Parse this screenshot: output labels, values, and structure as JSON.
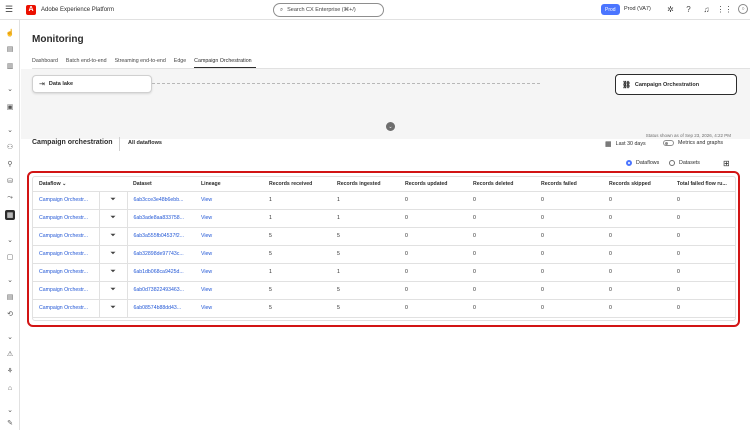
{
  "topbar": {
    "app_name": "Adobe Experience Platform",
    "search_placeholder": "Search CX Enterprise (⌘+/)",
    "env_badge": "Prod",
    "org": "Prod (VA7)"
  },
  "page": {
    "title": "Monitoring",
    "tabs": [
      "Dashboard",
      "Batch end-to-end",
      "Streaming end-to-end",
      "Edge",
      "Campaign Orchestration"
    ],
    "selected_tab": "Campaign Orchestration"
  },
  "flow": {
    "source": "Data lake",
    "destination": "Campaign Orchestration",
    "status_text": "Status shown as of Sep 23, 2026, 4:22 PM"
  },
  "section": {
    "title": "Campaign orchestration",
    "filter_label": "All dataflows",
    "date_range": "Last 30 days",
    "metrics_toggle": "Metrics and graphs",
    "radio_dataflows": "Dataflows",
    "radio_datasets": "Datasets",
    "selected_view": "Dataflows"
  },
  "table": {
    "columns": [
      "Dataflow",
      "",
      "Dataset",
      "Lineage",
      "Records received",
      "Records ingested",
      "Records updated",
      "Records deleted",
      "Records failed",
      "Records skipped",
      "Total failed flow ru..."
    ],
    "rows": [
      {
        "dataflow": "Campaign Orchestr...",
        "dataset": "6ab3cce3e48b6ebb...",
        "lineage": "View",
        "received": "1",
        "ingested": "1",
        "updated": "0",
        "deleted": "0",
        "failed": "0",
        "skipped": "0",
        "failed_runs": "0"
      },
      {
        "dataflow": "Campaign Orchestr...",
        "dataset": "6ab3ade8aa833758...",
        "lineage": "View",
        "received": "1",
        "ingested": "1",
        "updated": "0",
        "deleted": "0",
        "failed": "0",
        "skipped": "0",
        "failed_runs": "0"
      },
      {
        "dataflow": "Campaign Orchestr...",
        "dataset": "6ab3a555fb04537f2...",
        "lineage": "View",
        "received": "5",
        "ingested": "5",
        "updated": "0",
        "deleted": "0",
        "failed": "0",
        "skipped": "0",
        "failed_runs": "0"
      },
      {
        "dataflow": "Campaign Orchestr...",
        "dataset": "6ab32898de97743c...",
        "lineage": "View",
        "received": "5",
        "ingested": "5",
        "updated": "0",
        "deleted": "0",
        "failed": "0",
        "skipped": "0",
        "failed_runs": "0"
      },
      {
        "dataflow": "Campaign Orchestr...",
        "dataset": "6ab1db068ca9425d...",
        "lineage": "View",
        "received": "1",
        "ingested": "1",
        "updated": "0",
        "deleted": "0",
        "failed": "0",
        "skipped": "0",
        "failed_runs": "0"
      },
      {
        "dataflow": "Campaign Orchestr...",
        "dataset": "6ab0d73822493463...",
        "lineage": "View",
        "received": "5",
        "ingested": "5",
        "updated": "0",
        "deleted": "0",
        "failed": "0",
        "skipped": "0",
        "failed_runs": "0"
      },
      {
        "dataflow": "Campaign Orchestr...",
        "dataset": "6ab08574b88dd43...",
        "lineage": "View",
        "received": "5",
        "ingested": "5",
        "updated": "0",
        "deleted": "0",
        "failed": "0",
        "skipped": "0",
        "failed_runs": "0"
      }
    ]
  },
  "colors": {
    "accent": "#4b75ff",
    "link": "#2358d6",
    "highlight": "#d21414",
    "brand": "#eb1000"
  },
  "icons": {
    "topbar": [
      "hamburger-icon",
      "adobe-logo-icon",
      "search-icon",
      "help-icon",
      "notifications-icon",
      "apps-grid-icon",
      "avatar"
    ],
    "rail": [
      "home-icon",
      "dashboard-icon",
      "browse-icon",
      "schema-icon",
      "segment-icon",
      "profile-icon",
      "identity-icon",
      "location-icon",
      "dataset-icon",
      "connections-icon",
      "monitoring-icon",
      "queries-icon",
      "sandbox-icon",
      "alerts-icon",
      "data-governance-icon",
      "tag-icon",
      "edit-icon"
    ]
  }
}
